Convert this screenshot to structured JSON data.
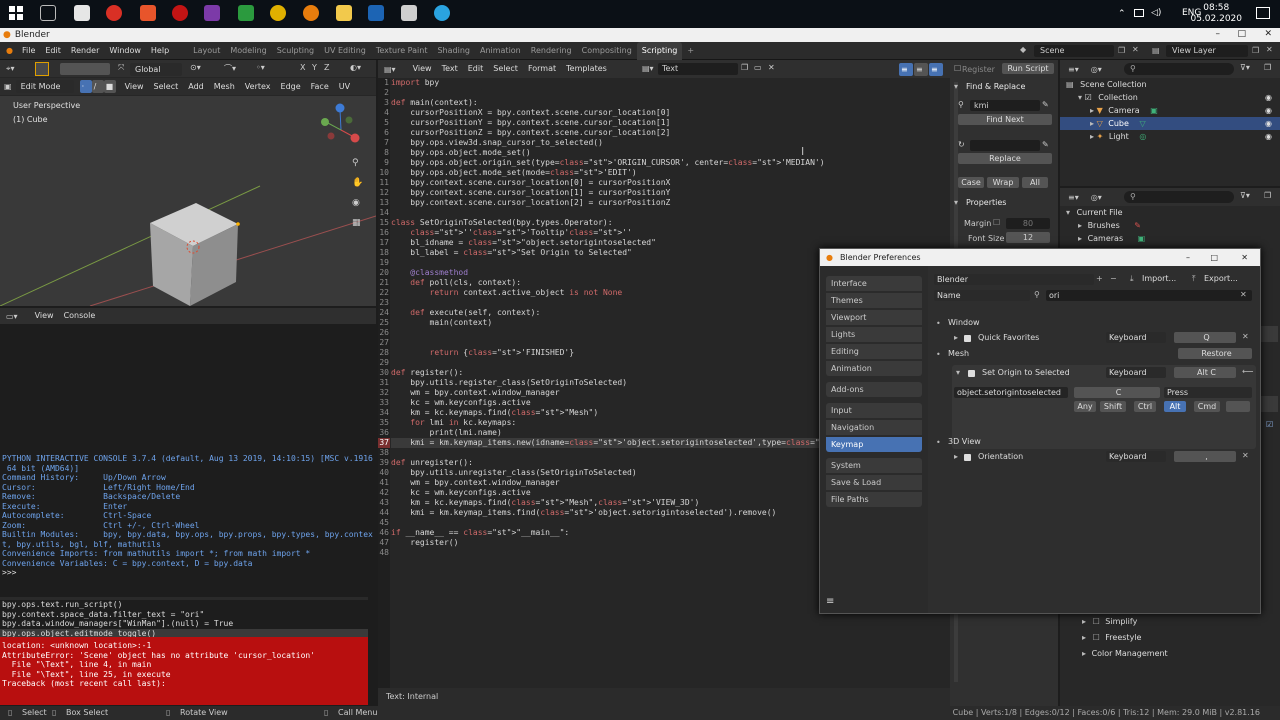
{
  "taskbar": {
    "clock_time": "08:58",
    "clock_date": "05.02.2020",
    "language": "ENG"
  },
  "window": {
    "title": "Blender"
  },
  "menubar": {
    "items": [
      "File",
      "Edit",
      "Render",
      "Window",
      "Help"
    ],
    "workspaces": [
      "Layout",
      "Modeling",
      "Sculpting",
      "UV Editing",
      "Texture Paint",
      "Shading",
      "Animation",
      "Rendering",
      "Compositing",
      "Scripting"
    ],
    "active_workspace": "Scripting",
    "scene_label": "Scene",
    "view_layer_label": "View Layer"
  },
  "viewport": {
    "transform_orientation": "Global",
    "mode": "Edit Mode",
    "header_menus": [
      "View",
      "Select",
      "Add",
      "Mesh",
      "Vertex",
      "Edge",
      "Face",
      "UV"
    ],
    "axis_labels": [
      "X",
      "Y",
      "Z"
    ],
    "view_title": "User Perspective",
    "object_label": "(1) Cube"
  },
  "console": {
    "header_menus": [
      "View",
      "Console"
    ],
    "lines": [
      "PYTHON INTERACTIVE CONSOLE 3.7.4 (default, Aug 13 2019, 14:10:15) [MSC v.1916",
      " 64 bit (AMD64)]",
      "",
      "Command History:     Up/Down Arrow",
      "Cursor:              Left/Right Home/End",
      "Remove:              Backspace/Delete",
      "Execute:             Enter",
      "Autocomplete:        Ctrl-Space",
      "Zoom:                Ctrl +/-, Ctrl-Wheel",
      "Builtin Modules:     bpy, bpy.data, bpy.ops, bpy.props, bpy.types, bpy.contex",
      "t, bpy.utils, bgl, blf, mathutils",
      "Convenience Imports: from mathutils import *; from math import *",
      "Convenience Variables: C = bpy.context, D = bpy.data",
      "",
      ">>> "
    ]
  },
  "info": {
    "lines": [
      "bpy.ops.text.run_script()",
      "bpy.context.space_data.filter_text = \"ori\"",
      "bpy.data.window_managers[\"WinMan\"].(null) = True",
      "bpy.ops.object.editmode_toggle()"
    ],
    "error_lines": [
      "location: <unknown location>:-1",
      "",
      "AttributeError: 'Scene' object has no attribute 'cursor_location'",
      "  File \"\\Text\", line 4, in main",
      "  File \"\\Text\", line 25, in execute",
      "Traceback (most recent call last):"
    ]
  },
  "editor": {
    "header_menus": [
      "View",
      "Text",
      "Edit",
      "Select",
      "Format",
      "Templates"
    ],
    "text_name": "Text",
    "register_label": "Register",
    "run_script_label": "Run Script",
    "footer": "Text: Internal",
    "code_lines": [
      "import bpy",
      "",
      "def main(context):",
      "    cursorPositionX = bpy.context.scene.cursor_location[0]",
      "    cursorPositionY = bpy.context.scene.cursor_location[1]",
      "    cursorPositionZ = bpy.context.scene.cursor_location[2]",
      "    bpy.ops.view3d.snap_cursor_to_selected()",
      "    bpy.ops.object.mode_set()",
      "    bpy.ops.object.origin_set(type='ORIGIN_CURSOR', center='MEDIAN')",
      "    bpy.ops.object.mode_set(mode='EDIT')",
      "    bpy.context.scene.cursor_location[0] = cursorPositionX",
      "    bpy.context.scene.cursor_location[1] = cursorPositionY",
      "    bpy.context.scene.cursor_location[2] = cursorPositionZ",
      "",
      "class SetOriginToSelected(bpy.types.Operator):",
      "    '''Tooltip'''",
      "    bl_idname = \"object.setorigintoselected\"",
      "    bl_label = \"Set Origin to Selected\"",
      "",
      "    @classmethod",
      "    def poll(cls, context):",
      "        return context.active_object is not None",
      "",
      "    def execute(self, context):",
      "        main(context)",
      "",
      "",
      "        return {'FINISHED'}",
      "",
      "def register():",
      "    bpy.utils.register_class(SetOriginToSelected)",
      "    wm = bpy.context.window_manager",
      "    kc = wm.keyconfigs.active",
      "    km = kc.keymaps.find(\"Mesh\")",
      "    for lmi in kc.keymaps:",
      "        print(lmi.name)",
      "    kmi = km.keymap_items.new(idname='object.setorigintoselected',type='C',value='PRESS')",
      "",
      "def unregister():",
      "    bpy.utils.unregister_class(SetOriginToSelected)",
      "    wm = bpy.context.window_manager",
      "    kc = wm.keyconfigs.active",
      "    km = kc.keymaps.find(\"Mesh\",'VIEW_3D')",
      "    kmi = km.keymap_items.find('object.setorigintoselected').remove()",
      "",
      "if __name__ == \"__main__\":",
      "    register()",
      ""
    ]
  },
  "find_panel": {
    "title": "Find & Replace",
    "find_value": "kmi",
    "find_next_label": "Find Next",
    "replace_label": "Replace",
    "case_label": "Case",
    "wrap_label": "Wrap",
    "all_label": "All",
    "properties_title": "Properties",
    "margin_label": "Margin",
    "margin_value": "80",
    "font_size_label": "Font Size",
    "font_size_value": "12"
  },
  "outliner": {
    "scene_collection": "Scene Collection",
    "collection": "Collection",
    "items": [
      "Camera",
      "Cube",
      "Light"
    ]
  },
  "properties": {
    "current_file": "Current File",
    "items": [
      "Brushes",
      "Cameras"
    ],
    "sections": [
      "Simplify",
      "Freestyle",
      "Color Management"
    ]
  },
  "prefs": {
    "title": "Blender Preferences",
    "nav": [
      [
        "Interface",
        "Themes",
        "Viewport",
        "Lights",
        "Editing",
        "Animation"
      ],
      [
        "Add-ons"
      ],
      [
        "Input",
        "Navigation",
        "Keymap"
      ],
      [
        "System",
        "Save & Load",
        "File Paths"
      ]
    ],
    "selected_nav": "Keymap",
    "preset": "Blender",
    "import_label": "Import...",
    "export_label": "Export...",
    "filter_mode": "Name",
    "filter_text": "ori",
    "window_section": "Window",
    "quick_favorites": "Quick Favorites",
    "keyboard": "Keyboard",
    "quick_favorites_key": "Q",
    "mesh_section": "Mesh",
    "restore_label": "Restore",
    "set_origin_label": "Set Origin to Selected",
    "set_origin_key": "Alt C",
    "idname": "object.setorigintoselected",
    "key_type": "C",
    "value": "Press",
    "modifiers": [
      "Any",
      "Shift",
      "Ctrl",
      "Alt",
      "Cmd"
    ],
    "active_modifier": "Alt",
    "view3d_section": "3D View",
    "orientation": "Orientation",
    "orientation_key": ","
  },
  "statusbar": {
    "select": "Select",
    "box_select": "Box Select",
    "rotate_view": "Rotate View",
    "call_menu": "Call Menu",
    "stats": "Cube | Verts:1/8 | Edges:0/12 | Faces:0/6 | Tris:12 | Mem: 29.0 MiB | v2.81.16"
  },
  "colors": {
    "accent": "#4772b3",
    "error": "#b80f0f",
    "keyword": "#d16a6a",
    "string": "#e2c25c"
  }
}
